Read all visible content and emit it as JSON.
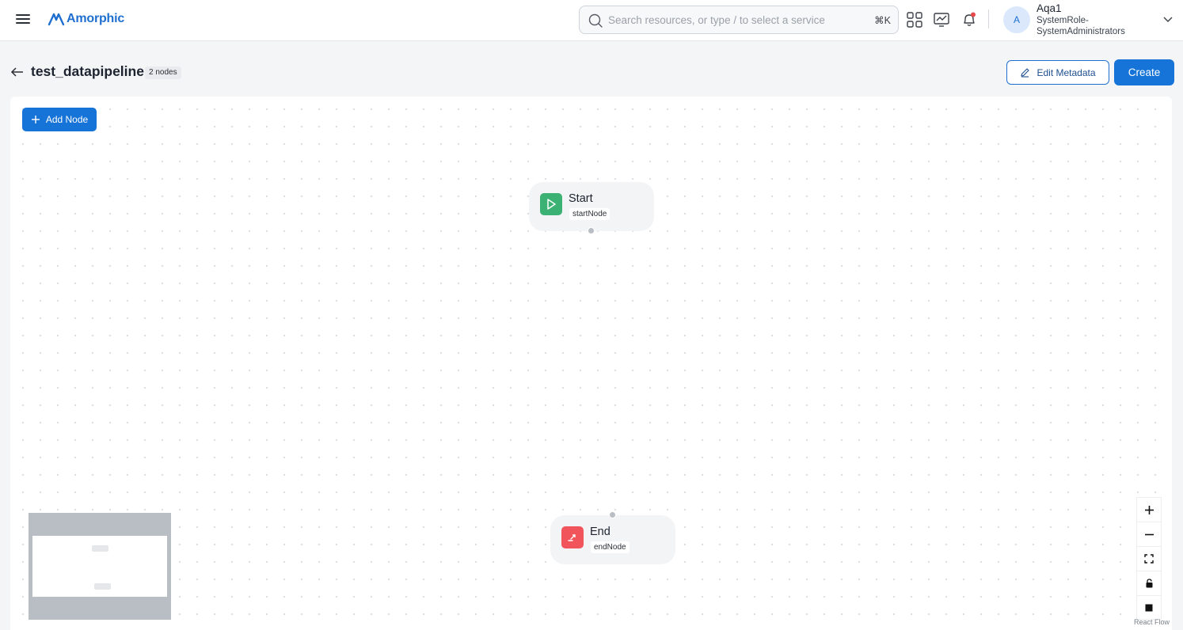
{
  "header": {
    "app_name": "Amorphic",
    "search": {
      "placeholder": "Search resources, or type / to select a service",
      "shortcut": "⌘K"
    },
    "user": {
      "initial": "A",
      "name": "Aqa1",
      "role": "SystemRole-SystemAdministrators"
    },
    "icons": [
      "menu-icon",
      "apps-grid-icon",
      "monitor-chart-icon",
      "bell-icon",
      "chevron-down-icon"
    ]
  },
  "page": {
    "title": "test_datapipeline",
    "node_count_badge": "2 nodes",
    "edit_metadata_label": "Edit Metadata",
    "create_label": "Create"
  },
  "canvas": {
    "add_node_label": "Add Node",
    "nodes": [
      {
        "title": "Start",
        "type": "startNode",
        "color": "#3bb273",
        "icon": "play-icon"
      },
      {
        "title": "End",
        "type": "endNode",
        "color": "#f2545b",
        "icon": "exit-icon"
      }
    ],
    "attribution": "React Flow",
    "controls": [
      "zoom-in-icon",
      "zoom-out-icon",
      "fit-view-icon",
      "lock-icon",
      "square-icon"
    ]
  },
  "colors": {
    "primary": "#1673d8",
    "brand": "#1f6fd1",
    "notification_dot": "#e5484d"
  }
}
